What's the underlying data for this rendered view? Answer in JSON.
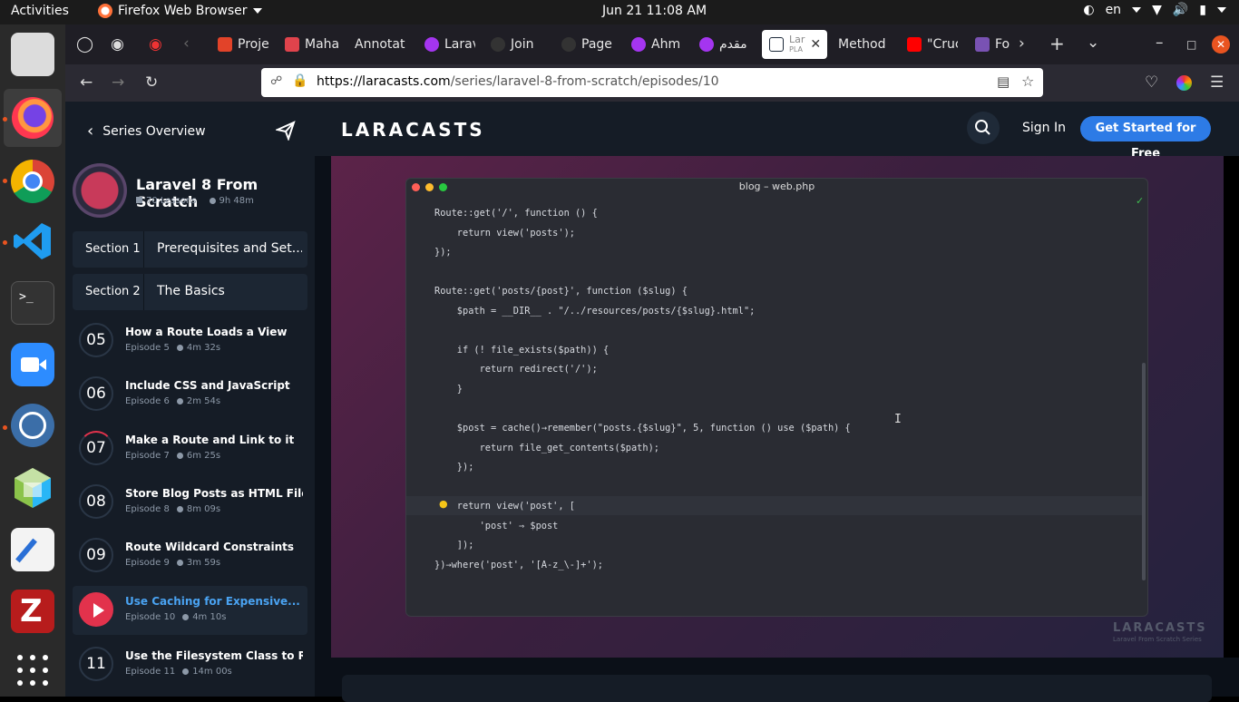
{
  "topbar": {
    "activities": "Activities",
    "app_name": "Firefox Web Browser",
    "clock": "Jun 21  11:08 AM",
    "lang": "en"
  },
  "dock": {
    "items": [
      "files",
      "firefox",
      "chrome",
      "vscode",
      "terminal",
      "zoom",
      "tracker",
      "virtualbox",
      "text-editor",
      "filezilla",
      "apps-grid"
    ]
  },
  "tabs": [
    {
      "label": "Proje",
      "icon": "gitlab-icon",
      "color": "#e24329"
    },
    {
      "label": "Maha",
      "icon": "mahara-icon",
      "color": "#e0434c"
    },
    {
      "label": "Annotat",
      "icon": "",
      "color": ""
    },
    {
      "label": "Larav",
      "icon": "udemy-icon",
      "color": "#a435f0"
    },
    {
      "label": "Join",
      "icon": "github-icon",
      "color": "#333333"
    },
    {
      "label": "Page",
      "icon": "github-icon",
      "color": "#333333"
    },
    {
      "label": "Ahm",
      "icon": "udemy-icon",
      "color": "#a435f0"
    },
    {
      "label": "مقدم",
      "icon": "udemy-icon",
      "color": "#a435f0"
    },
    {
      "label": "Lar",
      "sublabel": "PLA",
      "icon": "laracasts-icon",
      "color": "#1d2a3a",
      "active": true
    },
    {
      "label": "Method",
      "icon": "",
      "color": ""
    },
    {
      "label": "\"Cruc",
      "icon": "youtube-icon",
      "color": "#ff0000"
    },
    {
      "label": "Fo",
      "icon": "bootstrap-icon",
      "color": "#7952b3"
    }
  ],
  "urlbar": {
    "host": "https://laracasts.com",
    "path": "/series/laravel-8-from-scratch/episodes/10"
  },
  "sidebar": {
    "back_label": "Series Overview",
    "series_title": "Laravel 8 From Scratch",
    "lessons": "70 Lessons",
    "duration": "9h 48m",
    "sections": [
      {
        "num": "Section 1",
        "name": "Prerequisites and Set..."
      },
      {
        "num": "Section 2",
        "name": "The Basics"
      }
    ],
    "episodes": [
      {
        "num": "05",
        "title": "How a Route Loads a View",
        "episode": "Episode 5",
        "time": "4m 32s"
      },
      {
        "num": "06",
        "title": "Include CSS and JavaScript",
        "episode": "Episode 6",
        "time": "2m 54s"
      },
      {
        "num": "07",
        "title": "Make a Route and Link to it",
        "episode": "Episode 7",
        "time": "6m 25s"
      },
      {
        "num": "08",
        "title": "Store Blog Posts as HTML Files",
        "episode": "Episode 8",
        "time": "8m 09s"
      },
      {
        "num": "09",
        "title": "Route Wildcard Constraints",
        "episode": "Episode 9",
        "time": "3m 59s"
      },
      {
        "num": "",
        "title": "Use Caching for Expensive...",
        "episode": "Episode 10",
        "time": "4m 10s",
        "active": true
      },
      {
        "num": "11",
        "title": "Use the Filesystem Class to Read ...",
        "episode": "Episode 11",
        "time": "14m 00s"
      }
    ]
  },
  "header": {
    "logo": "LARACASTS",
    "sign_in": "Sign In",
    "cta": "Get Started for Free"
  },
  "video": {
    "window_title": "blog – web.php",
    "code": "Route::get('/', function () {\n    return view('posts');\n});\n\nRoute::get('posts/{post}', function ($slug) {\n    $path = __DIR__ . \"/../resources/posts/{$slug}.html\";\n\n    if (! file_exists($path)) {\n        return redirect('/');\n    }\n\n    $post = cache()→remember(\"posts.{$slug}\", 5, function () use ($path) {\n        return file_get_contents($path);\n    });\n\n    return view('post', [\n        'post' ⇒ $post\n    ]);\n})→where('post', '[A-z_\\-]+');",
    "watermark": "LARACASTS",
    "watermark_sub": "Laravel From Scratch Series"
  }
}
